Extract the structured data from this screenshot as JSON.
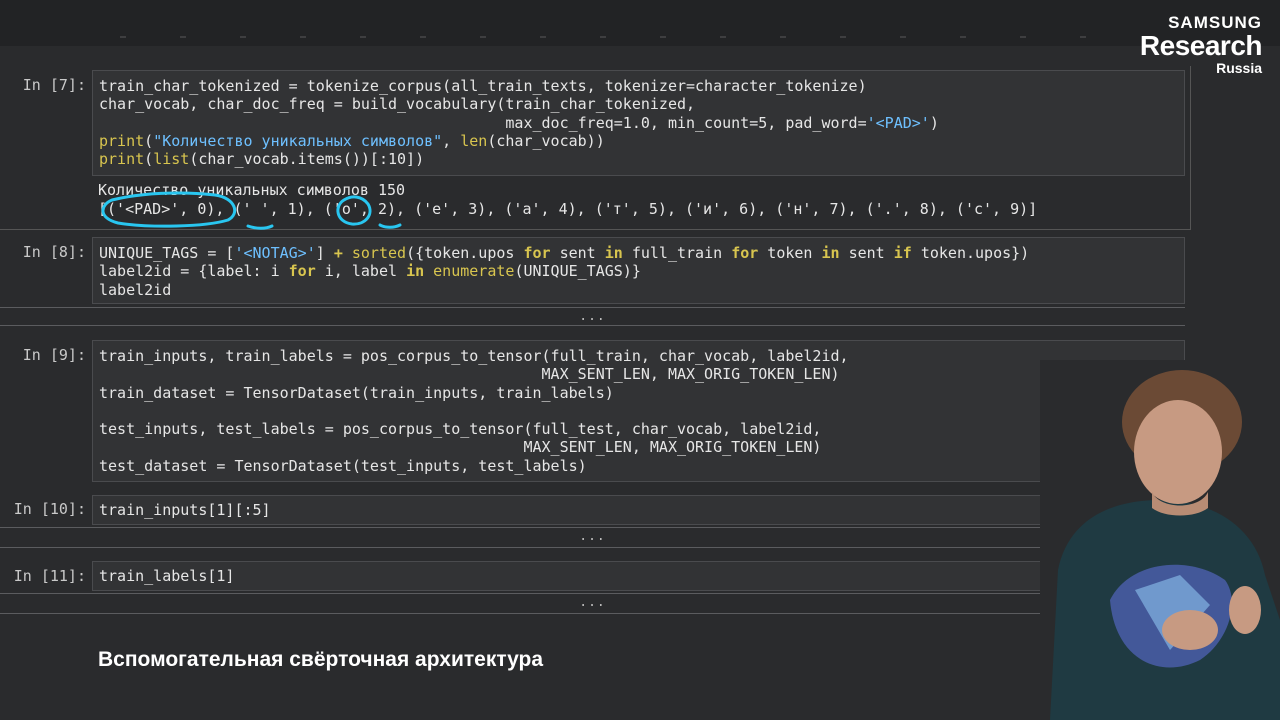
{
  "branding": {
    "line1": "SAMSUNG",
    "line2": "Research",
    "line3": "Russia"
  },
  "cells": {
    "c7": {
      "prompt": "In [7]:",
      "output": [
        "Количество уникальных символов 150",
        "[('<PAD>', 0), (' ', 1), ('о', 2), ('е', 3), ('а', 4), ('т', 5), ('и', 6), ('н', 7), ('.', 8), ('с', 9)]"
      ]
    },
    "c8": {
      "prompt": "In [8]:",
      "ellipsis": "..."
    },
    "c9": {
      "prompt": "In [9]:"
    },
    "c10": {
      "prompt": "In [10]:",
      "ellipsis": "..."
    },
    "c11": {
      "prompt": "In [11]:",
      "ellipsis": "..."
    }
  },
  "code": {
    "c7": [
      [
        [
          "",
          "train_char_tokenized = tokenize_corpus(all_train_texts, tokenizer=character_tokenize)"
        ]
      ],
      [
        [
          "",
          "char_vocab, char_doc_freq = build_vocabulary(train_char_tokenized,"
        ]
      ],
      [
        [
          "",
          "                                             max_doc_freq=1.0, min_count=5, pad_word="
        ],
        [
          "str",
          "'<PAD>'"
        ],
        [
          "",
          ")"
        ]
      ],
      [
        [
          "fn",
          "print"
        ],
        [
          "",
          "("
        ],
        [
          "str",
          "\"Количество уникальных символов\""
        ],
        [
          "",
          ", "
        ],
        [
          "fn",
          "len"
        ],
        [
          "",
          "(char_vocab))"
        ]
      ],
      [
        [
          "fn",
          "print"
        ],
        [
          "",
          "("
        ],
        [
          "fn",
          "list"
        ],
        [
          "",
          "(char_vocab.items())[:10])"
        ]
      ]
    ],
    "c8": [
      [
        [
          "",
          "UNIQUE_TAGS = ["
        ],
        [
          "str",
          "'<NOTAG>'"
        ],
        [
          "",
          "] "
        ],
        [
          "kw",
          "+"
        ],
        [
          "",
          " "
        ],
        [
          "fn",
          "sorted"
        ],
        [
          "",
          "({token.upos "
        ],
        [
          "kw",
          "for"
        ],
        [
          "",
          " sent "
        ],
        [
          "kw",
          "in"
        ],
        [
          "",
          " full_train "
        ],
        [
          "kw",
          "for"
        ],
        [
          "",
          " token "
        ],
        [
          "kw",
          "in"
        ],
        [
          "",
          " sent "
        ],
        [
          "kw",
          "if"
        ],
        [
          "",
          " token.upos})"
        ]
      ],
      [
        [
          "",
          "label2id = {label: i "
        ],
        [
          "kw",
          "for"
        ],
        [
          "",
          " i, label "
        ],
        [
          "kw",
          "in"
        ],
        [
          "",
          " "
        ],
        [
          "fn",
          "enumerate"
        ],
        [
          "",
          "(UNIQUE_TAGS)}"
        ]
      ],
      [
        [
          "",
          "label2id"
        ]
      ]
    ],
    "c9": [
      [
        [
          "",
          "train_inputs, train_labels = pos_corpus_to_tensor(full_train, char_vocab, label2id,"
        ]
      ],
      [
        [
          "",
          "                                                 MAX_SENT_LEN, MAX_ORIG_TOKEN_LEN)"
        ]
      ],
      [
        [
          "",
          "train_dataset = TensorDataset(train_inputs, train_labels)"
        ]
      ],
      [
        [
          "",
          ""
        ]
      ],
      [
        [
          "",
          "test_inputs, test_labels = pos_corpus_to_tensor(full_test, char_vocab, label2id,"
        ]
      ],
      [
        [
          "",
          "                                               MAX_SENT_LEN, MAX_ORIG_TOKEN_LEN)"
        ]
      ],
      [
        [
          "",
          "test_dataset = TensorDataset(test_inputs, test_labels)"
        ]
      ]
    ],
    "c10": [
      [
        [
          "",
          "train_inputs[1][:5]"
        ]
      ]
    ],
    "c11": [
      [
        [
          "",
          "train_labels[1]"
        ]
      ]
    ]
  },
  "markdown": {
    "heading": "Вспомогательная свёрточная архитектура"
  },
  "colors": {
    "keyword": "#d8c54f",
    "string": "#6ec0ff",
    "annotation": "#29c6f0"
  }
}
